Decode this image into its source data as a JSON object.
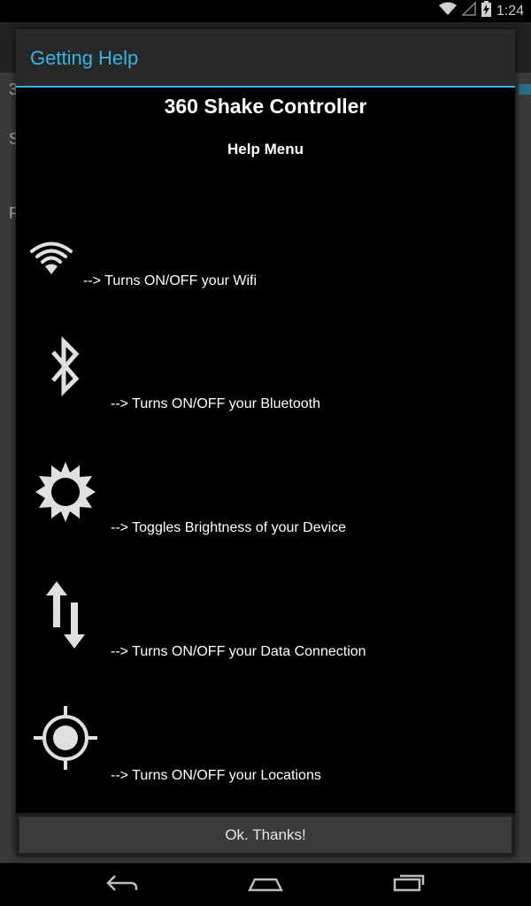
{
  "status_bar": {
    "time": "1:24",
    "icons": [
      "wifi-icon",
      "signal-icon",
      "battery-charging-icon"
    ]
  },
  "background_app": {
    "rows": [
      "3",
      "S",
      "F"
    ]
  },
  "dialog": {
    "title": "Getting Help",
    "app_title": "360 Shake Controller",
    "help_title": "Help Menu",
    "items": [
      {
        "icon": "wifi-icon",
        "text": "--> Turns ON/OFF your Wifi"
      },
      {
        "icon": "bluetooth-icon",
        "text": "--> Turns ON/OFF your Bluetooth"
      },
      {
        "icon": "brightness-icon",
        "text": "--> Toggles Brightness of your Device"
      },
      {
        "icon": "data-connection-icon",
        "text": "--> Turns ON/OFF your Data Connection"
      },
      {
        "icon": "location-icon",
        "text": "--> Turns ON/OFF your Locations"
      }
    ],
    "ok_button": "Ok. Thanks!"
  },
  "nav_bar": {
    "icons": [
      "back-icon",
      "home-icon",
      "recents-icon"
    ]
  },
  "colors": {
    "accent": "#33b5e5",
    "icon": "#e0e0e0",
    "dialog_bg": "#000000"
  }
}
